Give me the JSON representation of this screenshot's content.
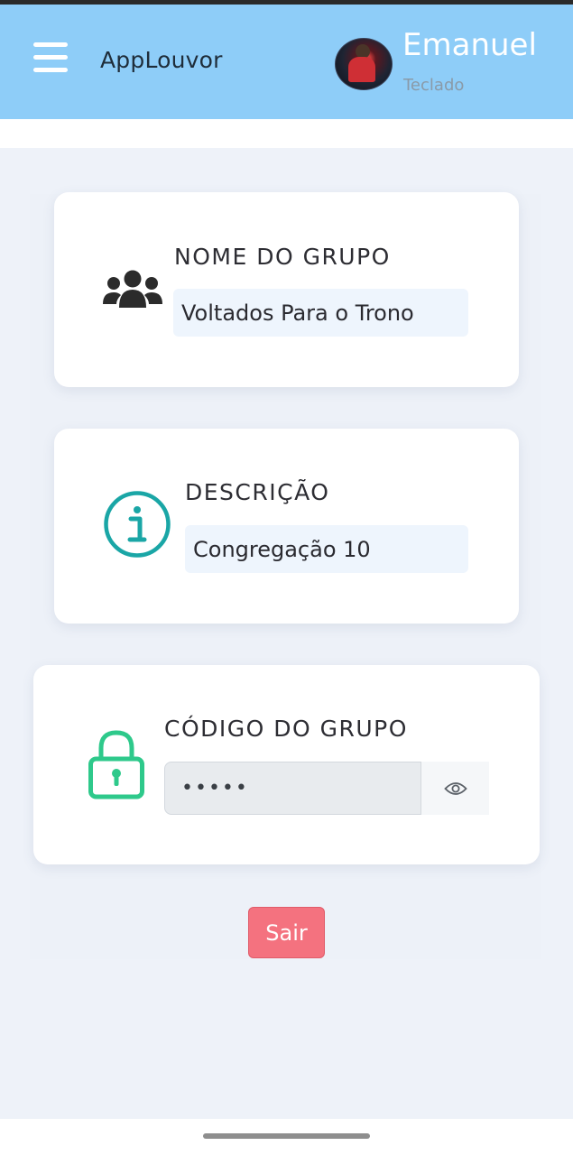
{
  "header": {
    "app_title": "AppLouvor",
    "user_name": "Emanuel",
    "user_role": "Teclado"
  },
  "group": {
    "name_label": "NOME DO GRUPO",
    "name_value": "Voltados Para o Trono",
    "description_label": "DESCRIÇÃO",
    "description_value": "Congregação 10",
    "code_label": "CÓDIGO DO GRUPO",
    "code_value": "•••••"
  },
  "actions": {
    "logout_label": "Sair"
  },
  "colors": {
    "topbar": "#8ecdf8",
    "info_icon": "#1aa6a6",
    "lock_icon": "#2ec98b",
    "logout_button": "#f4727f"
  },
  "icons": {
    "menu": "menu-icon",
    "group": "users-icon",
    "description": "info-icon",
    "code": "lock-icon",
    "toggle_visibility": "eye-icon"
  }
}
